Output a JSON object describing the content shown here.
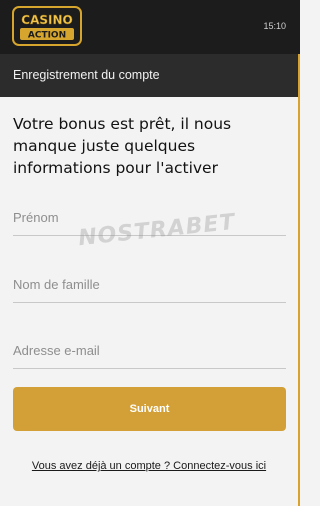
{
  "header": {
    "logo": {
      "line1": "CASINO",
      "line2": "ACTION"
    },
    "time": "15:10"
  },
  "titlebar": {
    "title": "Enregistrement du compte"
  },
  "form": {
    "headline": "Votre bonus est prêt, il nous manque juste quelques informations pour l'activer",
    "fields": [
      {
        "placeholder": "Prénom",
        "value": ""
      },
      {
        "placeholder": "Nom de famille",
        "value": ""
      },
      {
        "placeholder": "Adresse e-mail",
        "value": ""
      }
    ],
    "submit_label": "Suivant",
    "login_link": "Vous avez déjà un compte ? Connectez-vous ici"
  },
  "watermark": "NOSTRABET",
  "colors": {
    "accent": "#d3a037",
    "topbar": "#1c1c1c",
    "titlebar": "#2c2c2c",
    "background": "#f3f3f3"
  }
}
